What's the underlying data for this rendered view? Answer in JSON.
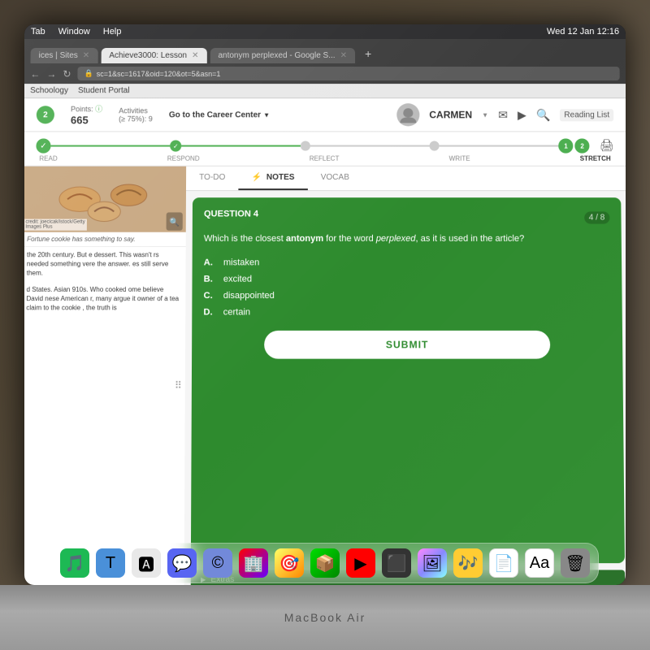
{
  "macbook": {
    "label": "MacBook Air"
  },
  "menubar": {
    "tab": "Tab",
    "window": "Window",
    "help": "Help",
    "datetime": "Wed 12 Jan  12:16"
  },
  "browser": {
    "tabs": [
      {
        "label": "ices | Sites ×",
        "active": false
      },
      {
        "label": "Achieve3000: Lesson",
        "active": true
      },
      {
        "label": "antonym perplexed - Google S...",
        "active": false
      }
    ],
    "address": "sc=1&sc=1617&oid=120&ot=5&asn=1",
    "bookmarks": [
      "Schoology",
      "Student Portal"
    ]
  },
  "header": {
    "points_label": "Points:",
    "points_value": "665",
    "activities_label": "Activities",
    "activities_value": "(≥ 75%): 9",
    "career_center": "Go to the Career Center",
    "user_name": "CARMEN",
    "reading_list": "Reading List"
  },
  "steps": {
    "labels": [
      "READ",
      "RESPOND",
      "REFLECT",
      "WRITE",
      "STRETCH"
    ],
    "active": "STRETCH",
    "stretch_numbers": [
      "1",
      "2"
    ]
  },
  "tabs": {
    "todo": "TO-DO",
    "notes": "NOTES",
    "vocab": "VOCAB"
  },
  "question": {
    "number": "QUESTION 4",
    "progress": "4 / 8",
    "text": "Which is the closest antonym for the word perplexed, as it is used in the article?",
    "options": [
      {
        "letter": "A.",
        "text": "mistaken"
      },
      {
        "letter": "B.",
        "text": "excited"
      },
      {
        "letter": "C.",
        "text": "disappointed"
      },
      {
        "letter": "D.",
        "text": "certain"
      }
    ],
    "submit_label": "SUBMIT",
    "extras_label": "Extras"
  },
  "article": {
    "credit": "credit: joecicak/istock/Getty\nImages Plus",
    "caption": "Fortune cookie has something to say.",
    "paragraphs": [
      "the 20th century. But e dessert. This wasn't rs needed something vere the answer. es still serve them.",
      "d States. Asian 910s. Who cooked ome believe David nese American r, many argue it owner of a tea claim to the cookie , the truth is"
    ]
  },
  "dock": {
    "icons": [
      "🎵",
      "T",
      "🅰",
      "💬",
      "©",
      "🏢",
      "🎯",
      "📦",
      "▶",
      "⬛",
      "🖼",
      "🎶",
      "📄",
      "Aa",
      "🗑"
    ]
  }
}
